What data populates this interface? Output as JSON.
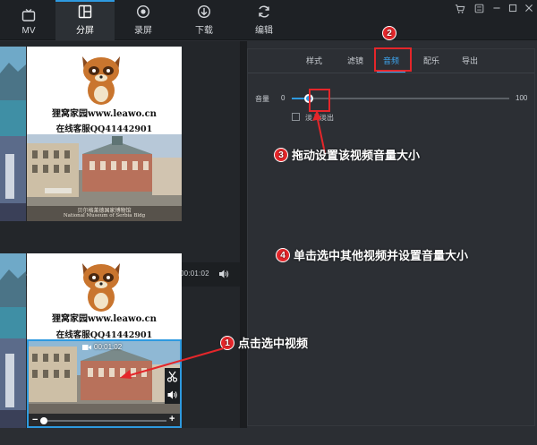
{
  "nav": {
    "tabs": [
      {
        "label": "MV",
        "icon": "tv-icon"
      },
      {
        "label": "分屏",
        "icon": "split-screen-icon"
      },
      {
        "label": "录屏",
        "icon": "record-icon"
      },
      {
        "label": "下载",
        "icon": "download-icon"
      },
      {
        "label": "编辑",
        "icon": "refresh-edit-icon"
      }
    ],
    "active_index": 1
  },
  "window_controls": [
    "cart-icon",
    "settings-icon",
    "minimize-icon",
    "maximize-icon",
    "close-icon"
  ],
  "preview": {
    "watermark_line1": "狸窝家园www.leawo.cn",
    "watermark_line2": "在线客服QQ41442901",
    "photo_caption_cn": "贝尔格莱德国家博物馆",
    "photo_caption_en": "National Museum of Serbia Bldg",
    "timecode": "00:00:00 / 00:01:02",
    "selected_clip_duration": "00:01:02"
  },
  "panel": {
    "tabs": [
      "样式",
      "滤镜",
      "音频",
      "配乐",
      "导出"
    ],
    "active_tab": 2,
    "volume_label": "音量",
    "volume_min": "0",
    "volume_max": "100",
    "volume_value": 0.08,
    "fade_label": "淡入淡出",
    "fade_checked": false
  },
  "annotations": [
    {
      "num": "1",
      "text": "点击选中视频"
    },
    {
      "num": "2",
      "text": ""
    },
    {
      "num": "3",
      "text": "拖动设置该视频音量大小"
    },
    {
      "num": "4",
      "text": "单击选中其他视频并设置音量大小"
    }
  ],
  "colors": {
    "accent": "#2e9ae0",
    "annotation": "#e4262a",
    "background": "#2b2e33"
  }
}
